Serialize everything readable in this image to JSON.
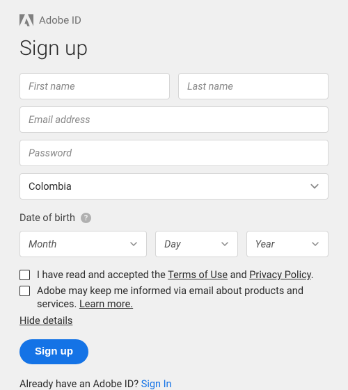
{
  "header": {
    "brand": "Adobe ID"
  },
  "title": "Sign up",
  "fields": {
    "first_name": {
      "placeholder": "First name",
      "value": ""
    },
    "last_name": {
      "placeholder": "Last name",
      "value": ""
    },
    "email": {
      "placeholder": "Email address",
      "value": ""
    },
    "password": {
      "placeholder": "Password",
      "value": ""
    }
  },
  "country": {
    "value": "Colombia"
  },
  "dob": {
    "label": "Date of birth",
    "month": "Month",
    "day": "Day",
    "year": "Year"
  },
  "consent": {
    "terms_prefix": "I have read and accepted the ",
    "terms": "Terms of Use",
    "and": " and ",
    "privacy": "Privacy Policy",
    "period": ".",
    "marketing_text": "Adobe may keep me informed via email about products and services. ",
    "learn_more": "Learn more.",
    "hide_details": "Hide details"
  },
  "buttons": {
    "submit": "Sign up"
  },
  "footer": {
    "prompt": "Already have an Adobe ID? ",
    "signin": "Sign In"
  },
  "icons": {
    "help": "?"
  }
}
